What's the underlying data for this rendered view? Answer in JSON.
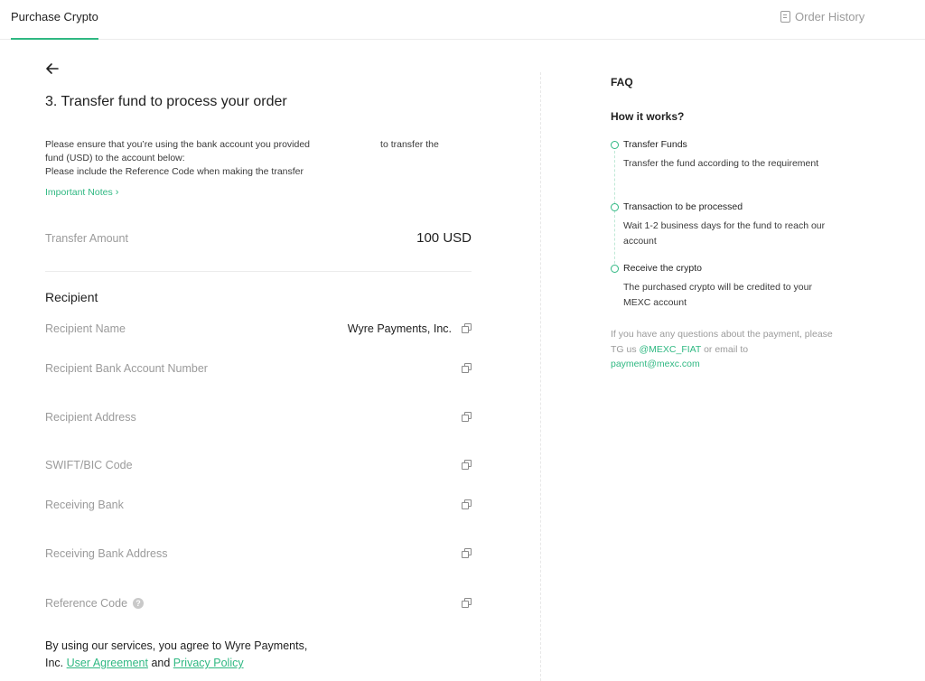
{
  "header": {
    "active_tab": "Purchase Crypto",
    "order_history": "Order History"
  },
  "main": {
    "step_title": "3. Transfer fund to process your order",
    "instructions": {
      "line1_start": "Please ensure that you’re using the bank account you provided",
      "line1_end": "to transfer the",
      "line2": "fund (USD) to the account below:",
      "line3": "Please include the Reference Code when making the transfer"
    },
    "important_notes": "Important Notes",
    "transfer_amount_label": "Transfer Amount",
    "transfer_amount_value": "100 USD",
    "recipient_heading": "Recipient",
    "fields": [
      {
        "label": "Recipient Name",
        "value": "Wyre Payments, Inc."
      },
      {
        "label": "Recipient Bank Account Number",
        "value": ""
      },
      {
        "label": "Recipient Address",
        "value": ""
      },
      {
        "label": "SWIFT/BIC Code",
        "value": ""
      },
      {
        "label": "Receiving Bank",
        "value": ""
      },
      {
        "label": "Receiving Bank Address",
        "value": ""
      },
      {
        "label": "Reference Code",
        "value": ""
      }
    ],
    "agreement": {
      "text_start": "By using our services, you agree to Wyre Payments, Inc.",
      "link1": "User Agreement",
      "and": "and",
      "link2": "Privacy Policy"
    }
  },
  "faq": {
    "title": "FAQ",
    "how_title": "How it works?",
    "steps": [
      {
        "name": "Transfer Funds",
        "desc": "Transfer the fund according to the requirement"
      },
      {
        "name": "Transaction to be processed",
        "desc": "Wait 1-2 business days for the fund to reach our account"
      },
      {
        "name": "Receive the crypto",
        "desc": "The purchased crypto will be credited to your MEXC account"
      }
    ],
    "questions": {
      "text1": "If you have any questions about the payment, please TG us",
      "tg": "@MEXC_FIAT",
      "text2": "or email to",
      "email": "payment@mexc.com"
    }
  },
  "colors": {
    "accent": "#2fb882",
    "muted": "#9b9b9b"
  }
}
